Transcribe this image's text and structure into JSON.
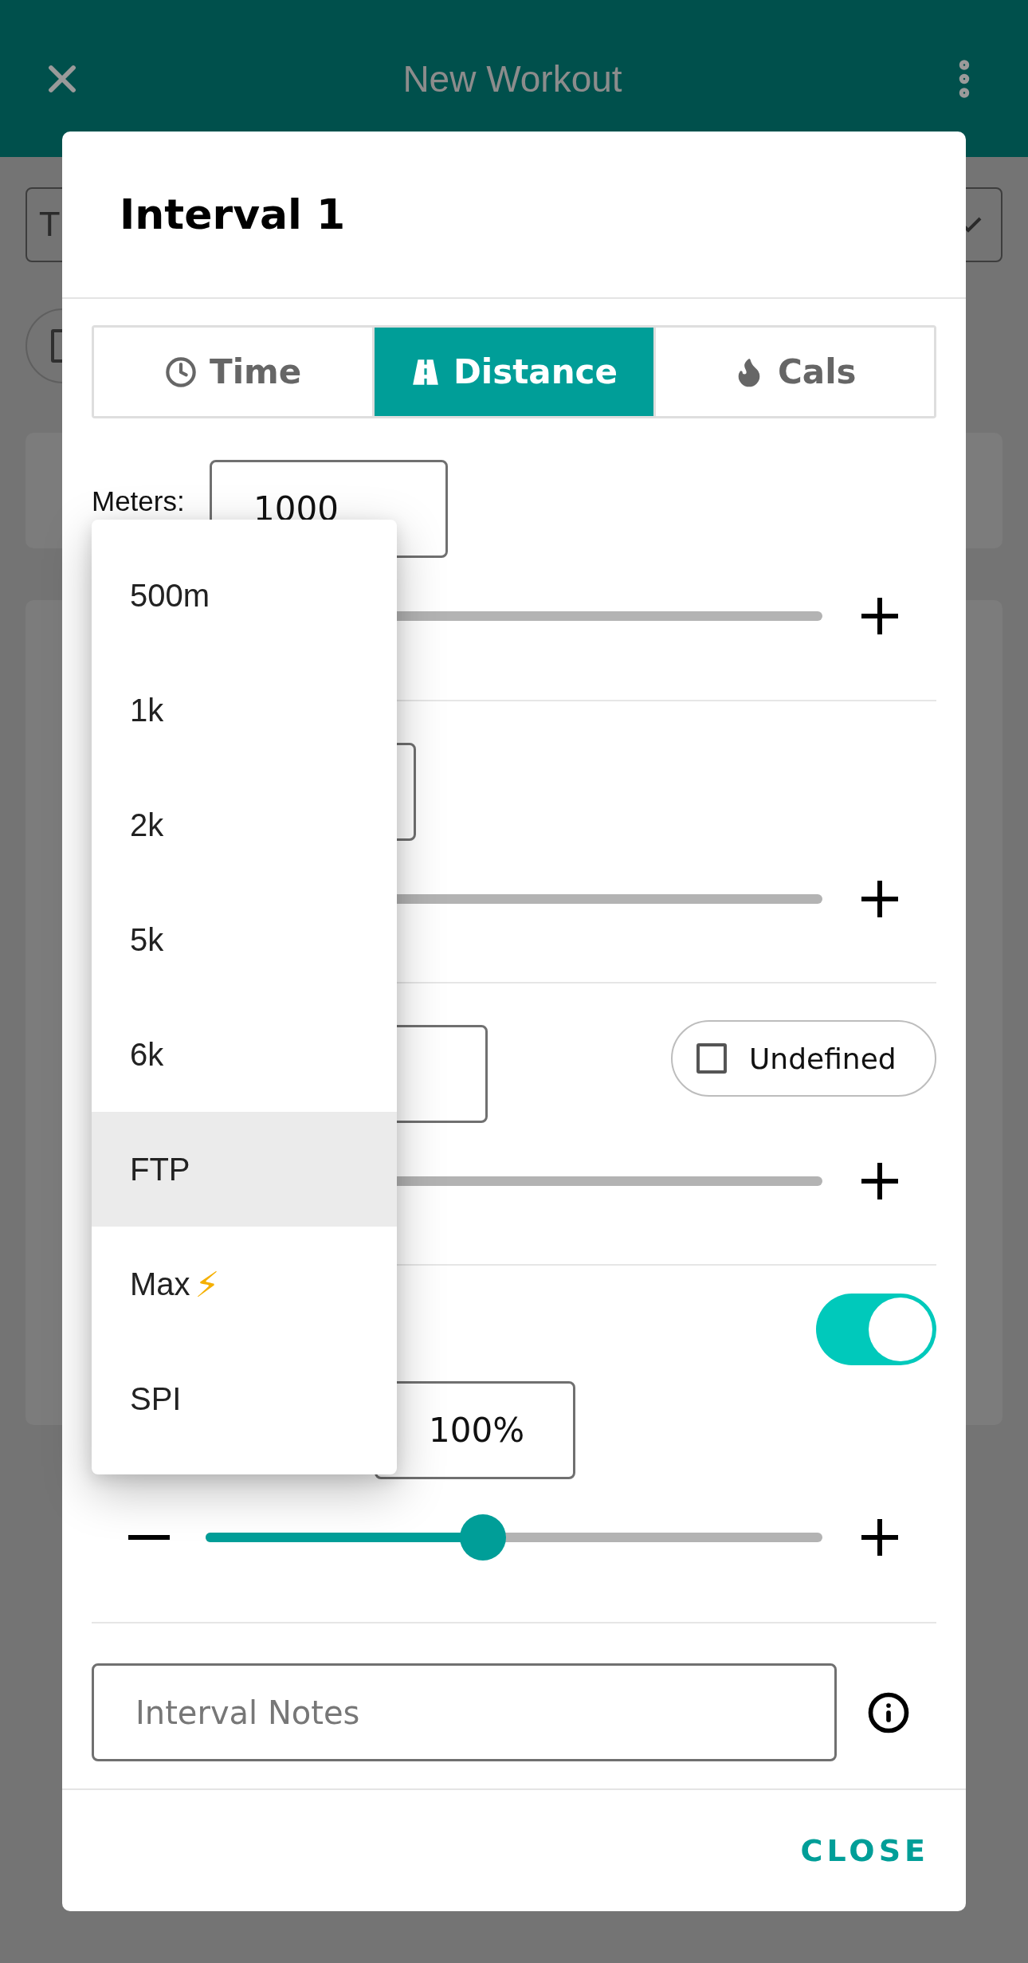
{
  "app_bar": {
    "title": "New Workout"
  },
  "background": {
    "field_value": "T"
  },
  "dialog": {
    "title": "Interval 1",
    "tabs": [
      {
        "label": "Time",
        "selected": false
      },
      {
        "label": "Distance",
        "selected": true
      },
      {
        "label": "Cals",
        "selected": false
      }
    ],
    "meters": {
      "label": "Meters:",
      "value": "1000"
    },
    "undefined_chip": {
      "label": "Undefined",
      "checked": false
    },
    "toggle": {
      "on": true
    },
    "intensity": {
      "value": "100%",
      "level": 0.45
    },
    "notes": {
      "placeholder": "Interval Notes"
    },
    "close_button": "CLOSE"
  },
  "dropdown": {
    "items": [
      {
        "label": "500m",
        "selected": false
      },
      {
        "label": "1k",
        "selected": false
      },
      {
        "label": "2k",
        "selected": false
      },
      {
        "label": "5k",
        "selected": false
      },
      {
        "label": "6k",
        "selected": false
      },
      {
        "label": "FTP",
        "selected": true
      },
      {
        "label": "Max",
        "symbol": "⚡",
        "selected": false
      },
      {
        "label": "SPI",
        "selected": false
      }
    ]
  }
}
